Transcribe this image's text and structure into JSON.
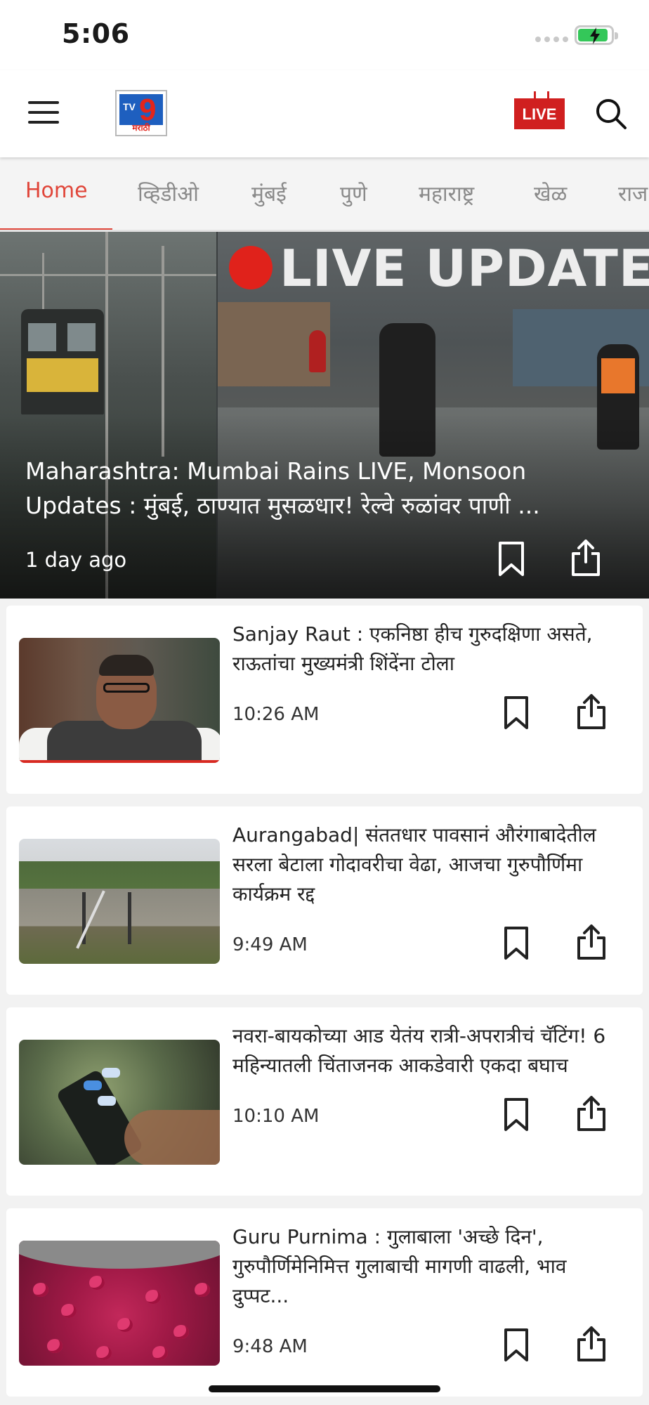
{
  "status_bar": {
    "time": "5:06"
  },
  "header": {
    "logo_sub": "मराठी",
    "live_label": "LIVE"
  },
  "tabs": [
    "Home",
    "व्हिडीओ",
    "मुंबई",
    "पुणे",
    "महाराष्ट्र",
    "खेळ",
    "राज"
  ],
  "active_tab": "Home",
  "hero": {
    "banner": "LIVE UPDATE",
    "headline": "Maharashtra: Mumbai Rains LIVE, Monsoon Updates : मुंबई, ठाण्यात मुसळधार! रेल्वे रुळांवर पाणी ...",
    "time": "1 day ago"
  },
  "articles": [
    {
      "headline": "Sanjay Raut : एकनिष्ठा हीच गुरुदक्षिणा असते, राऊतांचा मुख्यमंत्री शिंदेंना टोला",
      "time": "10:26 AM"
    },
    {
      "headline": "Aurangabad| संततधार पावसानं औरंगाबादेतील सरला बेटाला गोदावरीचा वेढा, आजचा गुरुपौर्णिमा कार्यक्रम रद्द",
      "time": "9:49 AM"
    },
    {
      "headline": "नवरा-बायकोच्या आड येतंय रात्री-अपरात्रीचं चॅटिंग! 6 महिन्यातली चिंताजनक आकडेवारी एकदा बघाच",
      "time": "10:10 AM"
    },
    {
      "headline": "Guru Purnima : गुलाबाला 'अच्छे दिन', गुरुपौर्णिमेनिमित्त गुलाबाची मागणी वाढली, भाव दुप्पट...",
      "time": "9:48 AM"
    }
  ],
  "colors": {
    "accent": "#e0463a",
    "live_red": "#d01f1f"
  },
  "icons": [
    "menu-icon",
    "search-icon",
    "bookmark-icon",
    "share-icon",
    "battery-icon"
  ]
}
